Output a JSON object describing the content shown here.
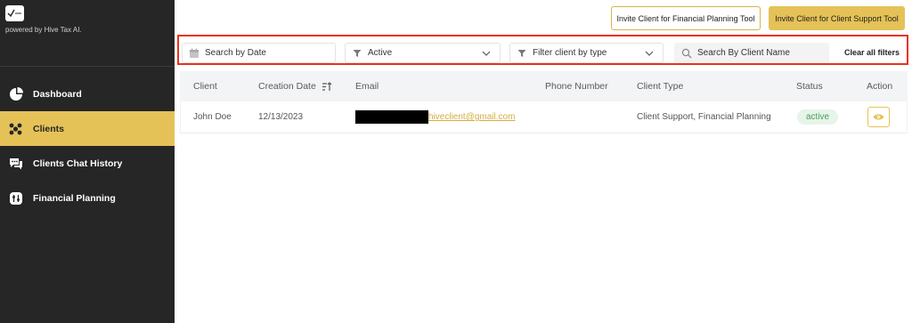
{
  "brand": {
    "powered_by": "powered by Hive Tax AI."
  },
  "sidebar": {
    "items": [
      {
        "label": "Dashboard",
        "icon": "pie-chart-icon",
        "active": false
      },
      {
        "label": "Clients",
        "icon": "users-icon",
        "active": true
      },
      {
        "label": "Clients Chat History",
        "icon": "chat-icon",
        "active": false
      },
      {
        "label": "Financial Planning",
        "icon": "sliders-icon",
        "active": false
      }
    ]
  },
  "header": {
    "invite_financial_label": "Invite Client for Financial Planning Tool",
    "invite_support_label": "Invite Client for Client Support Tool"
  },
  "filters": {
    "date_placeholder": "Search by Date",
    "status_value": "Active",
    "type_placeholder": "Filter client by type",
    "name_placeholder": "Search By Client Name",
    "clear_label": "Clear all filters"
  },
  "table": {
    "columns": [
      "Client",
      "Creation Date",
      "Email",
      "Phone Number",
      "Client Type",
      "Status",
      "Action"
    ],
    "rows": [
      {
        "client": "John Doe",
        "creation_date": "12/13/2023",
        "email_visible": "hiveclient@gmail.com",
        "phone": "",
        "client_type": "Client Support, Financial Planning",
        "status": "active"
      }
    ]
  },
  "colors": {
    "sidebar_bg": "#262626",
    "accent": "#e5c257",
    "highlight_border": "#e8331c",
    "status_green": "#4a9d5a"
  }
}
